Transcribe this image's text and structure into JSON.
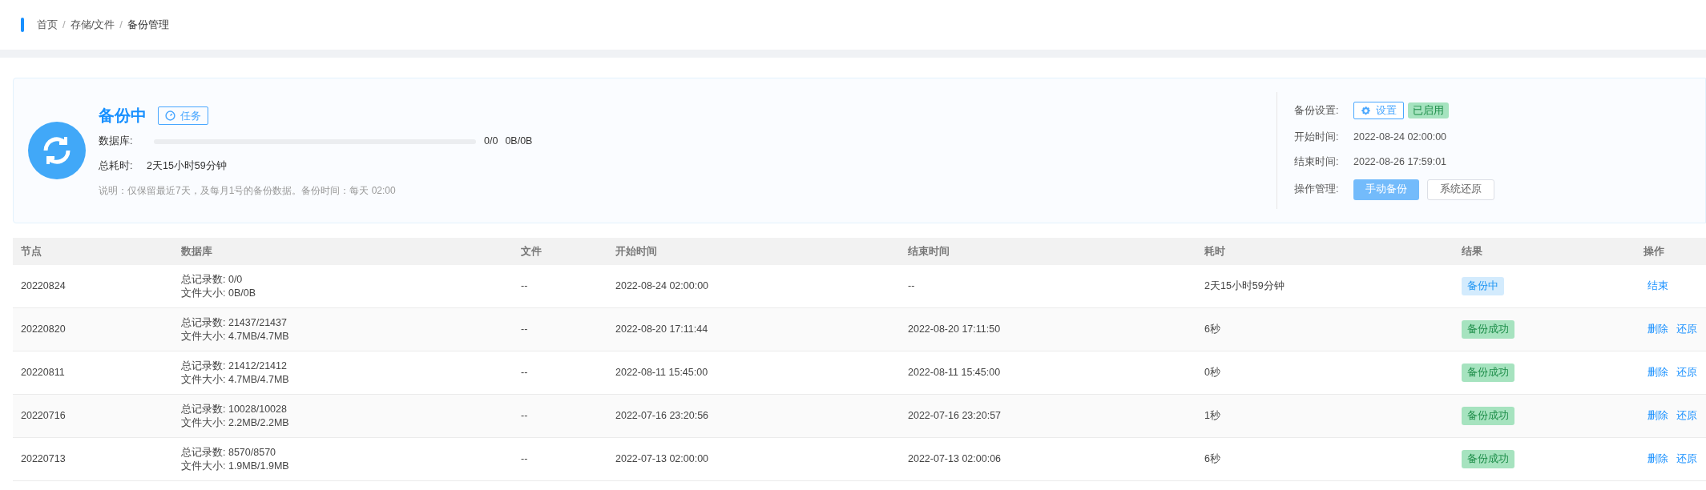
{
  "breadcrumb": {
    "separator": "/",
    "items": [
      "首页",
      "存储/文件",
      "备份管理"
    ]
  },
  "status": {
    "title": "备份中",
    "task_button": "任务",
    "database_label": "数据库:",
    "level": 0,
    "count": "0/0",
    "size": "0B/0B",
    "elapsed_label": "总耗时:",
    "elapsed": "2天15小时59分钟",
    "note": "说明：仅保留最近7天，及每月1号的备份数据。备份时间：每天 02:00"
  },
  "settings": {
    "settings_label": "备份设置:",
    "settings_button": "设置",
    "enabled_tag": "已启用",
    "start_label": "开始时间:",
    "start": "2022-08-24 02:00:00",
    "end_label": "结束时间:",
    "end": "2022-08-26 17:59:01",
    "ops_label": "操作管理:",
    "manual_button": "手动备份",
    "restore_button": "系统还原"
  },
  "table": {
    "columns": [
      "节点",
      "数据库",
      "文件",
      "开始时间",
      "结束时间",
      "耗时",
      "结果",
      "操作"
    ],
    "rows": [
      {
        "node": "20220824",
        "records": "总记录数: 0/0",
        "size": "文件大小: 0B/0B",
        "file": "--",
        "start": "2022-08-24 02:00:00",
        "end": "--",
        "duration": "2天15小时59分钟",
        "result": {
          "kind": "running",
          "text": "备份中"
        },
        "actions": [
          "结束"
        ]
      },
      {
        "node": "20220820",
        "records": "总记录数: 21437/21437",
        "size": "文件大小: 4.7MB/4.7MB",
        "file": "--",
        "start": "2022-08-20 17:11:44",
        "end": "2022-08-20 17:11:50",
        "duration": "6秒",
        "result": {
          "kind": "success",
          "text": "备份成功"
        },
        "actions": [
          "删除",
          "还原"
        ]
      },
      {
        "node": "20220811",
        "records": "总记录数: 21412/21412",
        "size": "文件大小: 4.7MB/4.7MB",
        "file": "--",
        "start": "2022-08-11 15:45:00",
        "end": "2022-08-11 15:45:00",
        "duration": "0秒",
        "result": {
          "kind": "success",
          "text": "备份成功"
        },
        "actions": [
          "删除",
          "还原"
        ]
      },
      {
        "node": "20220716",
        "records": "总记录数: 10028/10028",
        "size": "文件大小: 2.2MB/2.2MB",
        "file": "--",
        "start": "2022-07-16 23:20:56",
        "end": "2022-07-16 23:20:57",
        "duration": "1秒",
        "result": {
          "kind": "success",
          "text": "备份成功"
        },
        "actions": [
          "删除",
          "还原"
        ]
      },
      {
        "node": "20220713",
        "records": "总记录数: 8570/8570",
        "size": "文件大小: 1.9MB/1.9MB",
        "file": "--",
        "start": "2022-07-13 02:00:00",
        "end": "2022-07-13 02:00:06",
        "duration": "6秒",
        "result": {
          "kind": "success",
          "text": "备份成功"
        },
        "actions": [
          "删除",
          "还原"
        ]
      }
    ]
  }
}
